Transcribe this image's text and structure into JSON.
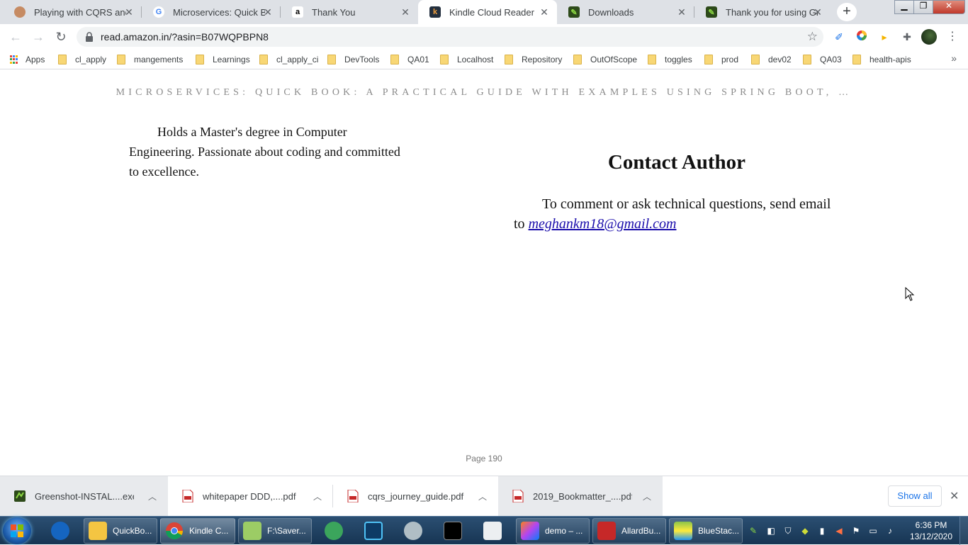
{
  "browser": {
    "tabs": [
      {
        "title": "Playing with CQRS and E",
        "favicon": "avatar-icon"
      },
      {
        "title": "Microservices: Quick Boo",
        "favicon": "google-icon"
      },
      {
        "title": "Thank You",
        "favicon": "amazon-icon"
      },
      {
        "title": "Kindle Cloud Reader",
        "favicon": "kindle-icon"
      },
      {
        "title": "Downloads",
        "favicon": "greenshot-icon"
      },
      {
        "title": "Thank you for using Gre",
        "favicon": "greenshot-icon"
      }
    ],
    "active_tab_index": 3,
    "url": "read.amazon.in/?asin=B07WQPBPN8",
    "bookmarks": {
      "apps_label": "Apps",
      "folders": [
        "cl_apply",
        "mangements",
        "Learnings",
        "cl_apply_ci",
        "DevTools",
        "QA01",
        "Localhost",
        "Repository",
        "OutOfScope",
        "toggles",
        "prod",
        "dev02",
        "QA03",
        "health-apis"
      ]
    }
  },
  "reader": {
    "book_header": "MICROSERVICES: QUICK BOOK: A PRACTICAL GUIDE WITH EXAMPLES USING SPRING BOOT, …",
    "bio_text": "Holds a Master's degree in Computer Engineering. Passionate about coding and committed to excellence.",
    "contact_title": "Contact Author",
    "contact_text": "To comment or ask technical questions, send email to ",
    "contact_email": "meghankm18@gmail.com",
    "page_label": "Page 190"
  },
  "downloads": {
    "items": [
      {
        "name": "Greenshot-INSTAL....exe",
        "type": "exe"
      },
      {
        "name": "whitepaper DDD,....pdf",
        "type": "pdf"
      },
      {
        "name": "cqrs_journey_guide.pdf",
        "type": "pdf"
      },
      {
        "name": "2019_Bookmatter_....pdf",
        "type": "pdf"
      }
    ],
    "show_all_label": "Show all"
  },
  "taskbar": {
    "items": [
      {
        "label": "QuickBo...",
        "icon": "folder-icon"
      },
      {
        "label": "Kindle C...",
        "icon": "chrome-icon"
      },
      {
        "label": "F:\\Saver...",
        "icon": "notepad-icon"
      },
      {
        "label": "demo – ...",
        "icon": "intellij-icon"
      },
      {
        "label": "AllardBu...",
        "icon": "pdf-icon"
      },
      {
        "label": "BlueStac...",
        "icon": "bluestacks-icon"
      }
    ],
    "clock": {
      "time": "6:36 PM",
      "date": "13/12/2020"
    }
  },
  "colors": {
    "tabstrip": "#dee1e6",
    "link": "#1a0dab",
    "accent": "#1a73e8",
    "taskbar": "#1f4266"
  }
}
